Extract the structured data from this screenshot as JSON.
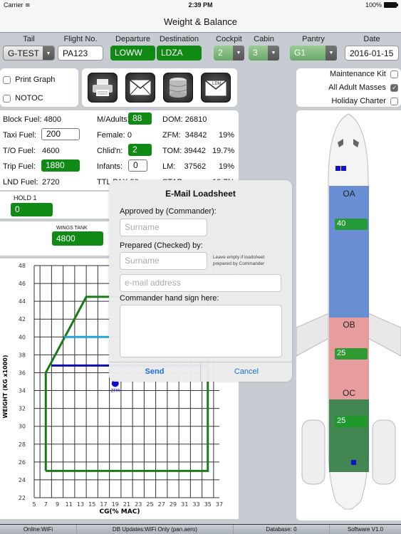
{
  "status_bar": {
    "carrier": "Carrier",
    "wifi_icon": "wifi-icon",
    "time": "2:39 PM",
    "battery": "100%"
  },
  "app_title": "Weight & Balance",
  "header": {
    "tail": {
      "label": "Tail",
      "value": "G-TEST"
    },
    "flight_no": {
      "label": "Flight No.",
      "value": "PA123"
    },
    "departure": {
      "label": "Departure",
      "value": "LOWW"
    },
    "destination": {
      "label": "Destination",
      "value": "LDZA"
    },
    "cockpit": {
      "label": "Cockpit",
      "value": "2"
    },
    "cabin": {
      "label": "Cabin",
      "value": "3"
    },
    "pantry": {
      "label": "Pantry",
      "value": "G1"
    },
    "date": {
      "label": "Date",
      "value": "2016-01-15"
    }
  },
  "options_left": [
    {
      "label": "Print Graph",
      "checked": false
    },
    {
      "label": "NOTOC",
      "checked": false
    }
  ],
  "toolbar_icons": [
    "printer-icon",
    "mail-icon",
    "database-icon",
    "ldm-mail-icon"
  ],
  "toolbar_ldm_text": "LDM",
  "options_right": [
    {
      "label": "Maintenance Kit",
      "checked": false
    },
    {
      "label": "All Adult Masses",
      "checked": true
    },
    {
      "label": "Holiday Charter",
      "checked": false
    }
  ],
  "fuel": {
    "block_label": "Block Fuel:",
    "block": "4800",
    "taxi_label": "Taxi Fuel:",
    "taxi": "200",
    "to_label": "T/O Fuel:",
    "to": "4600",
    "trip_label": "Trip Fuel:",
    "trip": "1880",
    "lnd_label": "LND Fuel:",
    "lnd": "2720"
  },
  "pax": {
    "adults_label": "M/Adults:",
    "adults": "88",
    "female_label": "Female:",
    "female": "0",
    "children_label": "Chlid'n:",
    "children": "2",
    "infants_label": "Infants:",
    "infants": "0",
    "ttl_label": "TTL PAX 90"
  },
  "masses": {
    "dom_label": "DOM:",
    "dom": "26810",
    "zfm_label": "ZFM:",
    "zfm": "34842",
    "zfm_pct": "19%",
    "tom_label": "TOM:",
    "tom": "39442",
    "tom_pct": "19.7%",
    "lm_label": "LM:",
    "lm": "37562",
    "lm_pct": "19%",
    "stab_label": "STAB",
    "stab_pct": "19.7%"
  },
  "holds": {
    "hold1_label": "HOLD 1",
    "hold1": "0"
  },
  "tanks": {
    "wings_label": "WINGS TANK",
    "wings": "4800"
  },
  "zones": [
    {
      "name": "OA",
      "pax": "40",
      "color": "#5b83d0"
    },
    {
      "name": "OB",
      "pax": "25",
      "color": "#e59494"
    },
    {
      "name": "OC",
      "pax": "25",
      "color": "#2f7a3f"
    }
  ],
  "modal": {
    "title": "E-Mail Loadsheet",
    "approved_label": "Approved by (Commander):",
    "approved_placeholder": "Surname",
    "prepared_label": "Prepared (Checked) by:",
    "prepared_placeholder": "Surname",
    "hint": "Leave empty if loadsheet prepared by Commander",
    "email_placeholder": "e-mail address",
    "sign_label": "Commander hand sign here:",
    "send": "Send",
    "cancel": "Cancel"
  },
  "chart_data": {
    "type": "line",
    "title": "",
    "xlabel": "CG(% MAC)",
    "ylabel": "WEIGHT (KG x1000)",
    "xlim": [
      5,
      37
    ],
    "ylim": [
      22,
      48
    ],
    "x_ticks": [
      5,
      7,
      9,
      11,
      13,
      15,
      17,
      19,
      21,
      23,
      25,
      27,
      29,
      31,
      33,
      35,
      37
    ],
    "y_ticks": [
      22,
      24,
      26,
      28,
      30,
      32,
      34,
      36,
      38,
      40,
      42,
      44,
      46,
      48
    ],
    "grid": true,
    "series": [
      {
        "name": "envelope",
        "color": "#1a7a1a",
        "points": [
          [
            7,
            25
          ],
          [
            7,
            36
          ],
          [
            14,
            44.5
          ],
          [
            35,
            44.5
          ],
          [
            35,
            25
          ],
          [
            7,
            25
          ]
        ]
      },
      {
        "name": "MTOW limit",
        "color": "#22a6d6",
        "points": [
          [
            10.2,
            40
          ],
          [
            35,
            40
          ]
        ]
      },
      {
        "name": "MZFW limit",
        "color": "#0a0ab0",
        "points": [
          [
            8,
            36.8
          ],
          [
            35,
            36.8
          ]
        ]
      }
    ],
    "markers": [
      {
        "label": "ZFM",
        "x": 19,
        "y": 34.8,
        "color": "#1010d0"
      }
    ]
  },
  "footer": {
    "online": "Online:WiFi",
    "db_updates": "DB Updates:WiFi Only   (pan.aero)",
    "database": "Database: 0",
    "software": "Software V1.0"
  }
}
